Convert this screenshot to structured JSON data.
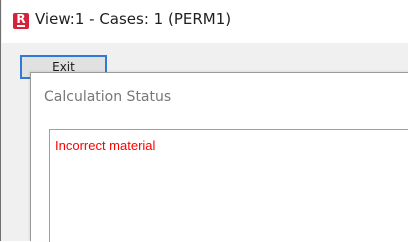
{
  "window": {
    "title": "View:1 - Cases: 1 (PERM1)",
    "icon": "app-r-icon",
    "icon_letter": "R"
  },
  "toolbar": {
    "exit_label": "Exit"
  },
  "dialog": {
    "title": "Calculation Status",
    "message": "Incorrect material",
    "message_color": "#ff0000"
  }
}
